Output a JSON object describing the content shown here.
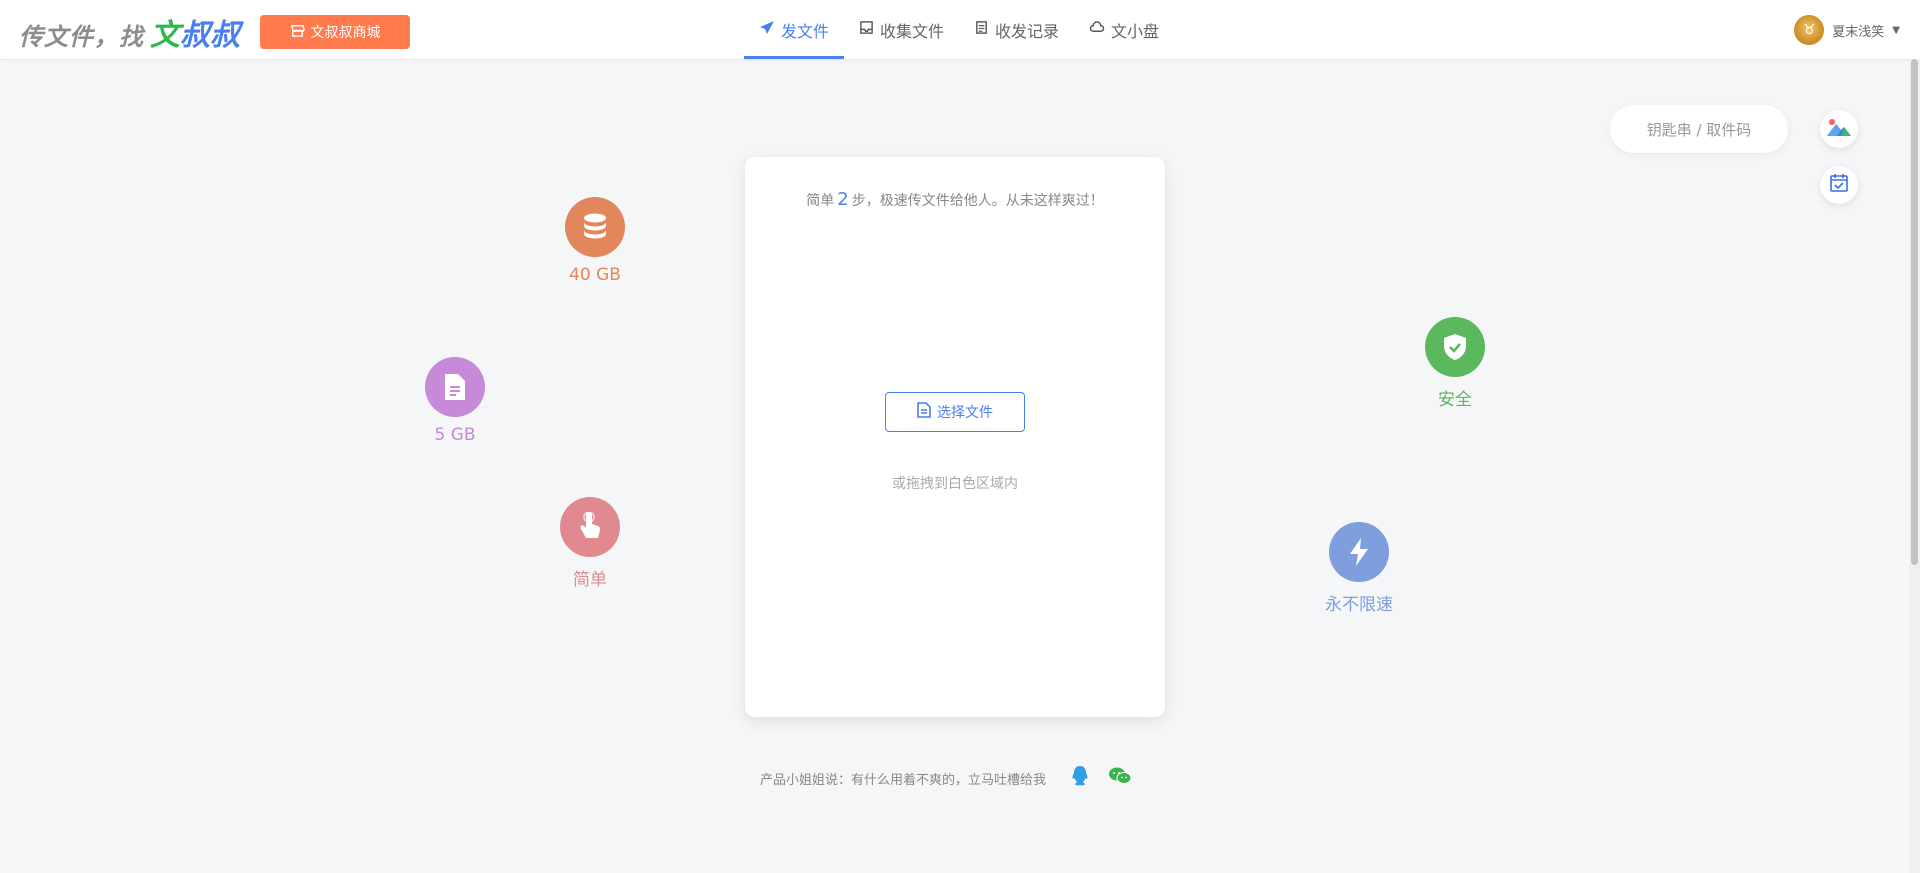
{
  "header": {
    "logo_prefix": "传文件，找",
    "logo_g": "文",
    "logo_b": "叔叔",
    "mall_button": "文叔叔商城",
    "nav": [
      {
        "label": "发文件",
        "icon": "send-icon",
        "active": true
      },
      {
        "label": "收集文件",
        "icon": "inbox-icon",
        "active": false
      },
      {
        "label": "收发记录",
        "icon": "record-icon",
        "active": false
      },
      {
        "label": "文小盘",
        "icon": "cloud-disk-icon",
        "active": false
      }
    ],
    "user_name": "夏末浅笑"
  },
  "pickup": {
    "placeholder": "钥匙串 / 取件码"
  },
  "card": {
    "tip_before": "简单",
    "tip_num": "2",
    "tip_after": "步，极速传文件给他人。从未这样爽过！",
    "select_button": "选择文件",
    "drag_tip": "或拖拽到白色区域内"
  },
  "features": [
    {
      "label": "40 GB",
      "icon": "database-icon",
      "color": "#e2865b"
    },
    {
      "label": "5 GB",
      "icon": "file-icon",
      "color": "#c68ad9"
    },
    {
      "label": "简单",
      "icon": "hand-pointer-icon",
      "color": "#e08a90"
    },
    {
      "label": "安全",
      "icon": "shield-check-icon",
      "color": "#5cb85c"
    },
    {
      "label": "永不限速",
      "icon": "lightning-icon",
      "color": "#7e9ede"
    }
  ],
  "footer": {
    "text": "产品小姐姐说：有什么用着不爽的，立马吐槽给我"
  }
}
